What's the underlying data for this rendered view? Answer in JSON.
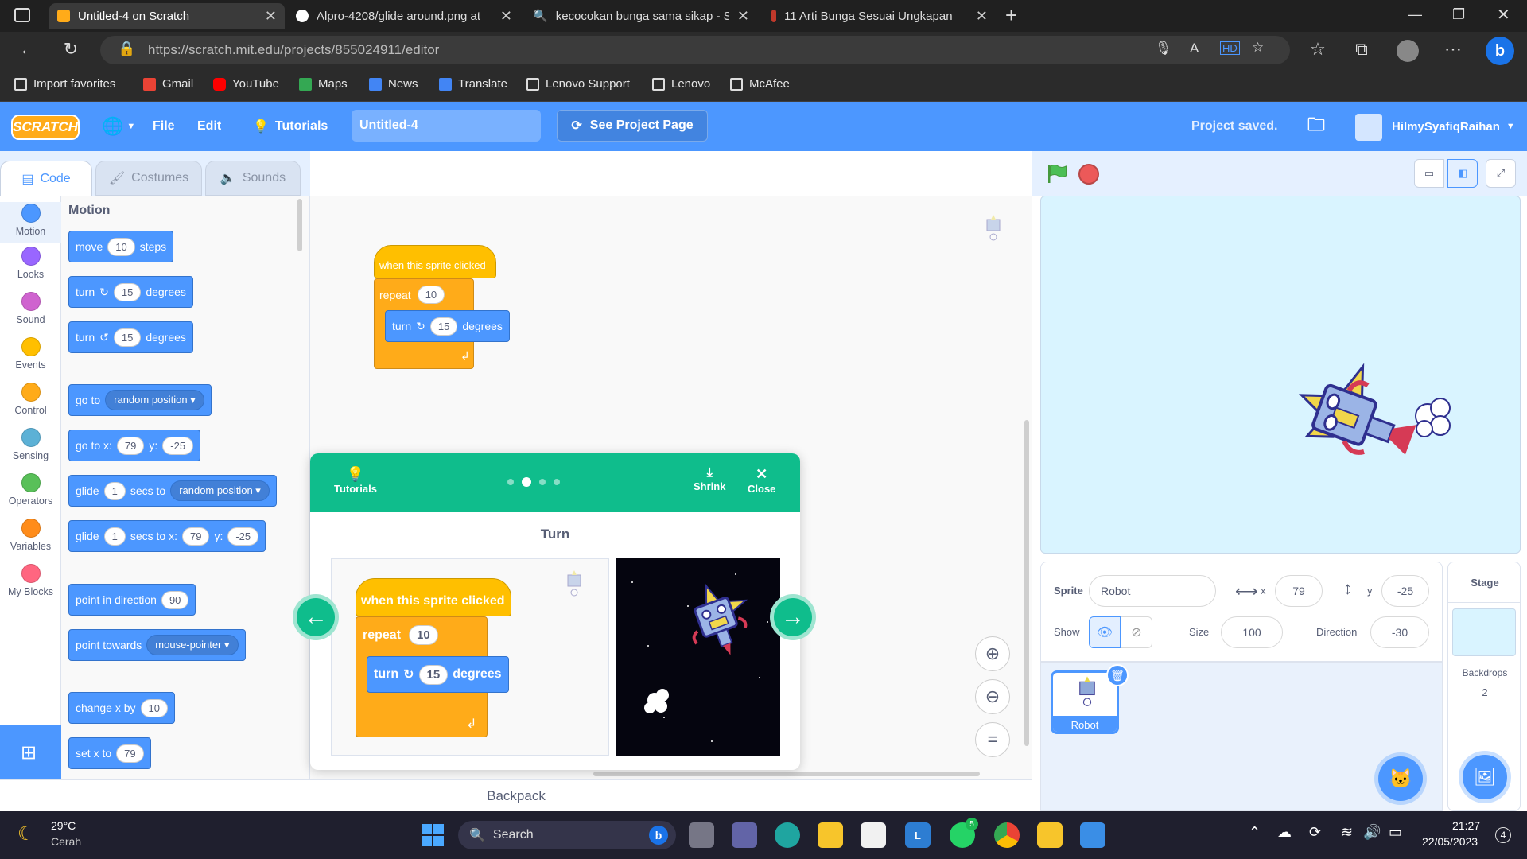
{
  "browser": {
    "tabs": [
      {
        "title": "Untitled-4 on Scratch",
        "active": true
      },
      {
        "title": "Alpro-4208/glide around.png at"
      },
      {
        "title": "kecocokan bunga sama sikap - S"
      },
      {
        "title": "11 Arti Bunga Sesuai Ungkapan"
      }
    ],
    "new_tab_glyph": "+",
    "url": "https://scratch.mit.edu/projects/855024911/editor",
    "bookmarks": [
      "Import favorites",
      "Gmail",
      "YouTube",
      "Maps",
      "News",
      "Translate",
      "Lenovo Support",
      "Lenovo",
      "McAfee"
    ]
  },
  "menubar": {
    "logo": "SCRATCH",
    "file": "File",
    "edit": "Edit",
    "tutorials": "Tutorials",
    "project_title": "Untitled-4",
    "see_project": "See Project Page",
    "saved": "Project saved.",
    "username": "HilmySyafiqRaihan"
  },
  "editor_tabs": {
    "code": "Code",
    "costumes": "Costumes",
    "sounds": "Sounds"
  },
  "categories": [
    {
      "label": "Motion",
      "color": "#4c97ff"
    },
    {
      "label": "Looks",
      "color": "#9966ff"
    },
    {
      "label": "Sound",
      "color": "#cf63cf"
    },
    {
      "label": "Events",
      "color": "#ffbf00"
    },
    {
      "label": "Control",
      "color": "#ffab19"
    },
    {
      "label": "Sensing",
      "color": "#5cb1d6"
    },
    {
      "label": "Operators",
      "color": "#59c059"
    },
    {
      "label": "Variables",
      "color": "#ff8c1a"
    },
    {
      "label": "My Blocks",
      "color": "#ff6680"
    }
  ],
  "palette": {
    "heading": "Motion",
    "blocks": {
      "move": {
        "a": "move",
        "v": "10",
        "b": "steps"
      },
      "turn_right": {
        "a": "turn",
        "v": "15",
        "b": "degrees"
      },
      "turn_left": {
        "a": "turn",
        "v": "15",
        "b": "degrees"
      },
      "go_to": {
        "a": "go to",
        "dd": "random position"
      },
      "go_to_xy": {
        "a": "go to x:",
        "x": "79",
        "b": "y:",
        "y": "-25"
      },
      "glide_to": {
        "a": "glide",
        "v": "1",
        "b": "secs to",
        "dd": "random position"
      },
      "glide_xy": {
        "a": "glide",
        "v": "1",
        "b": "secs to x:",
        "x": "79",
        "c": "y:",
        "y": "-25"
      },
      "point_dir": {
        "a": "point in direction",
        "v": "90"
      },
      "point_towards": {
        "a": "point towards",
        "dd": "mouse-pointer"
      },
      "change_x": {
        "a": "change x by",
        "v": "10"
      },
      "set_x": {
        "a": "set x to",
        "v": "79"
      }
    }
  },
  "script": {
    "hat": "when this sprite clicked",
    "repeat": "repeat",
    "repeat_count": "10",
    "turn": "turn",
    "turn_value": "15",
    "degrees": "degrees"
  },
  "tutorial": {
    "label": "Tutorials",
    "shrink": "Shrink",
    "close": "Close",
    "step_title": "Turn",
    "steps_total": 4,
    "current_step": 2,
    "hat": "when this sprite clicked",
    "repeat": "repeat",
    "repeat_count": "10",
    "turn": "turn",
    "turn_value": "15",
    "degrees": "degrees"
  },
  "sprite_info": {
    "sprite_label": "Sprite",
    "sprite_name": "Robot",
    "x_label": "x",
    "x": "79",
    "y_label": "y",
    "y": "-25",
    "show_label": "Show",
    "size_label": "Size",
    "size": "100",
    "direction_label": "Direction",
    "direction": "-30"
  },
  "sprites": [
    {
      "name": "Robot",
      "selected": true
    }
  ],
  "stage_panel": {
    "title": "Stage",
    "backdrops_label": "Backdrops",
    "backdrops_count": "2"
  },
  "backpack": "Backpack",
  "taskbar": {
    "temperature": "29°C",
    "weather": "Cerah",
    "search": "Search",
    "time": "21:27",
    "date": "22/05/2023",
    "whatsapp_badge": "5",
    "notif_count": "4"
  },
  "colors": {
    "scratch_blue": "#4c97ff",
    "tutorial_green": "#0fbd8c",
    "events_yellow": "#ffbf00",
    "control_orange": "#ffab19"
  }
}
